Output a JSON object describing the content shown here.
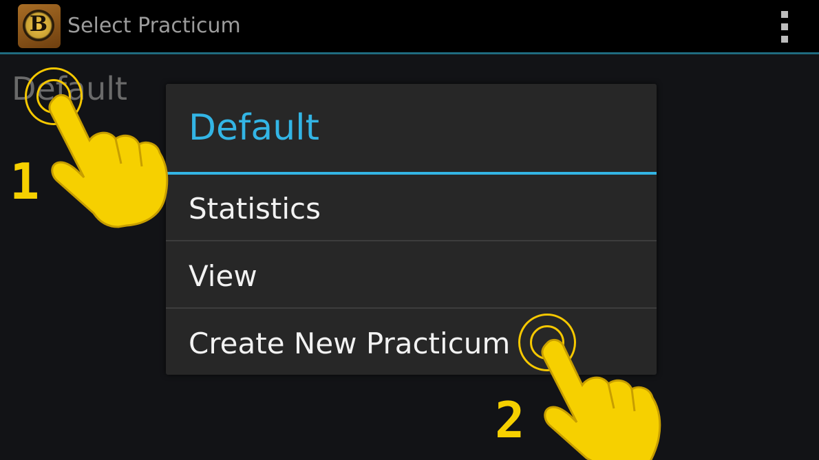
{
  "action_bar": {
    "app_icon_letter": "B",
    "title": "Select Practicum",
    "overflow_icon": "more-vertical-icon"
  },
  "list": {
    "items": [
      {
        "label": "Default"
      }
    ]
  },
  "context_menu": {
    "title": "Default",
    "items": [
      {
        "label": "Statistics"
      },
      {
        "label": "View"
      },
      {
        "label": "Create New Practicum"
      }
    ]
  },
  "tutorial_overlay": {
    "step_1": "1",
    "step_2": "2",
    "hand_icon": "pointing-hand-icon",
    "tap_icon": "tap-ripple-icon"
  },
  "colors": {
    "accent": "#33b5e5",
    "tutorial_yellow": "#f6d000",
    "background": "#121316",
    "action_bar": "#000000"
  }
}
